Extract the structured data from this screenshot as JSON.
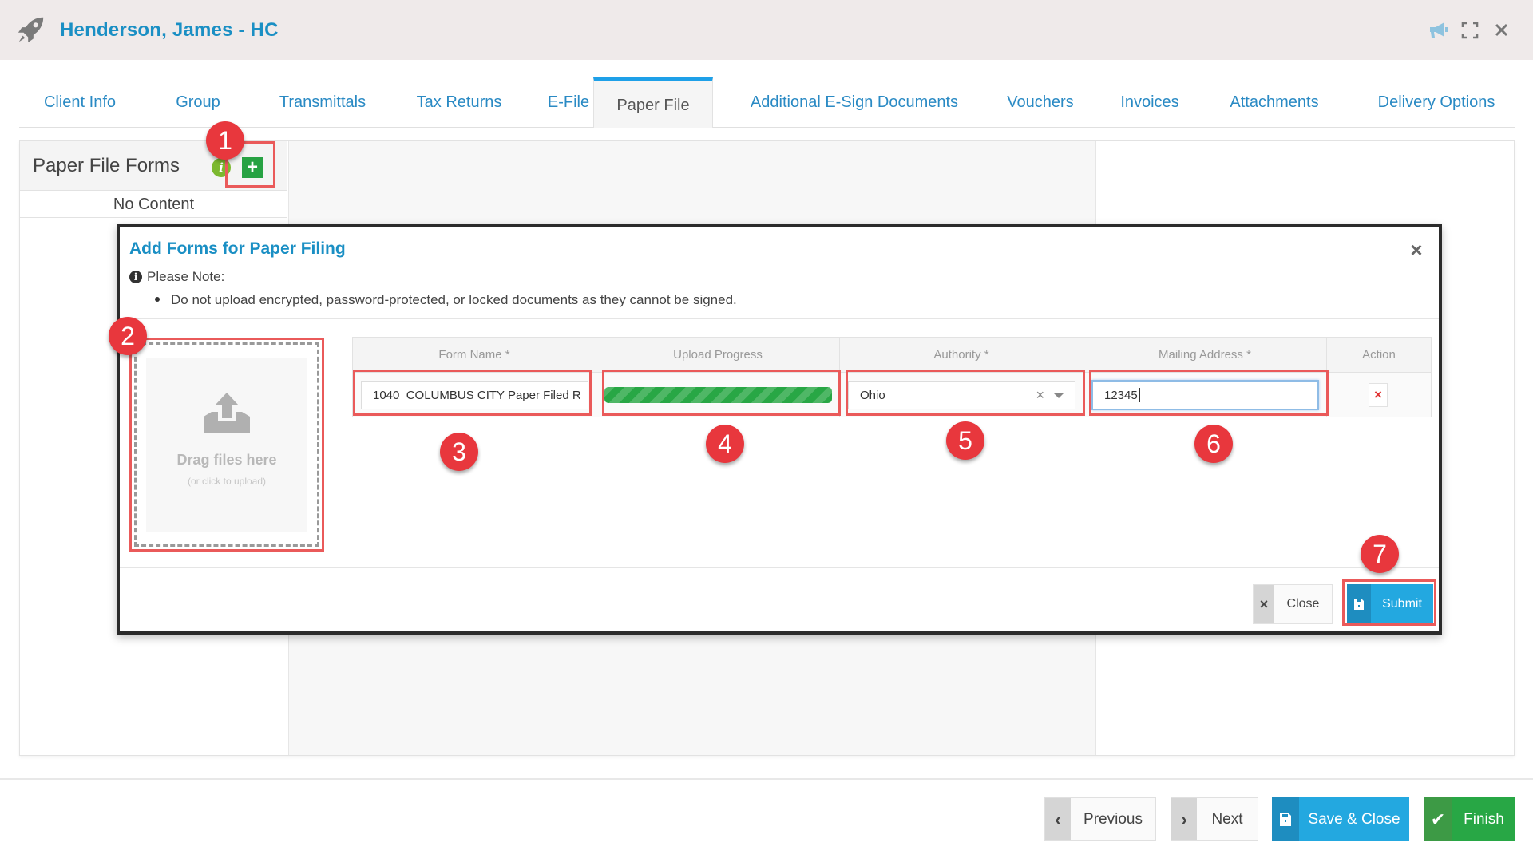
{
  "header": {
    "title": "Henderson, James - HC",
    "icons": [
      "rocket-icon",
      "megaphone-icon",
      "expand-icon",
      "close-icon"
    ]
  },
  "tabs": [
    {
      "label": "Client Info",
      "active": false
    },
    {
      "label": "Group",
      "active": false
    },
    {
      "label": "Transmittals",
      "active": false
    },
    {
      "label": "Tax Returns",
      "active": false
    },
    {
      "label": "E-File",
      "active": false
    },
    {
      "label": "Paper File",
      "active": true
    },
    {
      "label": "Additional E-Sign Documents",
      "active": false
    },
    {
      "label": "Vouchers",
      "active": false
    },
    {
      "label": "Invoices",
      "active": false
    },
    {
      "label": "Attachments",
      "active": false
    },
    {
      "label": "Delivery Options",
      "active": false
    }
  ],
  "forms_panel": {
    "title": "Paper File Forms",
    "info_icon": "i",
    "add_icon": "+",
    "empty_text": "No Content"
  },
  "dialog": {
    "title": "Add Forms for Paper Filing",
    "close_icon": "×",
    "note_icon": "i",
    "note_label": "Please Note:",
    "note_items": [
      "Do not upload encrypted, password-protected, or locked documents as they cannot be signed."
    ],
    "dropzone": {
      "label": "Drag files here",
      "sublabel": "(or click to upload)"
    },
    "table": {
      "columns": [
        "Form Name *",
        "Upload Progress",
        "Authority *",
        "Mailing Address *",
        "Action"
      ],
      "rows": [
        {
          "form_name": "1040_COLUMBUS CITY Paper Filed R",
          "upload_progress_percent": 100,
          "authority": "Ohio",
          "authority_clear_icon": "×",
          "mailing_address": "12345",
          "action_icon": "×"
        }
      ]
    },
    "close_button": {
      "icon": "×",
      "label": "Close"
    },
    "submit_button": {
      "label": "Submit"
    }
  },
  "annotations": [
    "1",
    "2",
    "3",
    "4",
    "5",
    "6",
    "7"
  ],
  "footer": {
    "previous": {
      "icon": "‹",
      "label": "Previous"
    },
    "next": {
      "icon": "›",
      "label": "Next"
    },
    "save_close": {
      "label": "Save & Close"
    },
    "finish": {
      "icon": "✔",
      "label": "Finish"
    }
  },
  "colors": {
    "brand_blue": "#1a8fc4",
    "active_tab_bar": "#1ea0e8",
    "success_green": "#28a745",
    "primary_button": "#23a8e0",
    "annotation_red": "#e8373d"
  }
}
